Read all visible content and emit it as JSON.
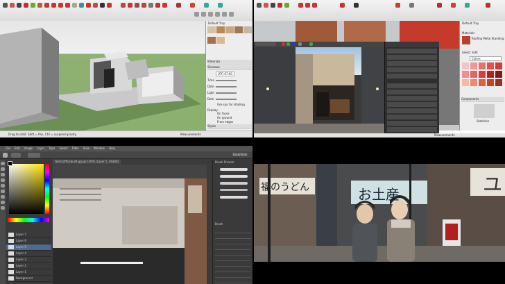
{
  "sketchup": {
    "panel_top_label": "Default Tray",
    "materials_label": "Materials",
    "shadows_label": "Shadows",
    "styles_label": "Styles",
    "instructor_label": "Instructor",
    "time_label": "Time",
    "date_label": "Date",
    "light_label": "Light",
    "dark_label": "Dark",
    "utc_value": "UTC-07:00",
    "display_label": "Display:",
    "on_faces": "On faces",
    "on_ground": "On ground",
    "from_edges": "From edges",
    "use_sun": "Use sun for shading",
    "status_text": "Drag to orbit. Shift = Pan, Ctrl = suspend gravity.",
    "measurements_label": "Measurements"
  },
  "render": {
    "panel_top_label": "Default Tray",
    "materials_label": "Materials",
    "select_label": "Select",
    "edit_label": "Edit",
    "colors_label": "Colors",
    "components_label": "Components",
    "statistics_label": "Statistics",
    "material_name": "Roofing Metal Standing Seam Gray",
    "measurements_label": "Measurements",
    "red_swatches": [
      "#f2c6c6",
      "#ec9a9a",
      "#e57373",
      "#e05050",
      "#d83a3a",
      "#ee8f8f",
      "#e06666",
      "#d14141",
      "#b32323",
      "#8f1414",
      "#f5b9a6",
      "#eb8c6e",
      "#e06040",
      "#c84424",
      "#a03018"
    ]
  },
  "photoshop": {
    "menu": [
      "File",
      "Edit",
      "Image",
      "Layer",
      "Type",
      "Select",
      "Filter",
      "View",
      "Window",
      "Help"
    ],
    "doc_tab": "Tok01officebuild.jpg @ 100% (Layer 5, RGB/8)",
    "essentials": "Essentials",
    "layers": [
      "Layer 7",
      "Layer 6",
      "Layer 5",
      "Layer 4",
      "Layer 3",
      "Layer 2",
      "Layer 1",
      "Background"
    ],
    "brush_labels": [
      "Brush Presets",
      "Brush"
    ]
  },
  "anime": {
    "sign_text": "お土産",
    "left_sign": "福のうどん",
    "right_sign": "ユ"
  }
}
